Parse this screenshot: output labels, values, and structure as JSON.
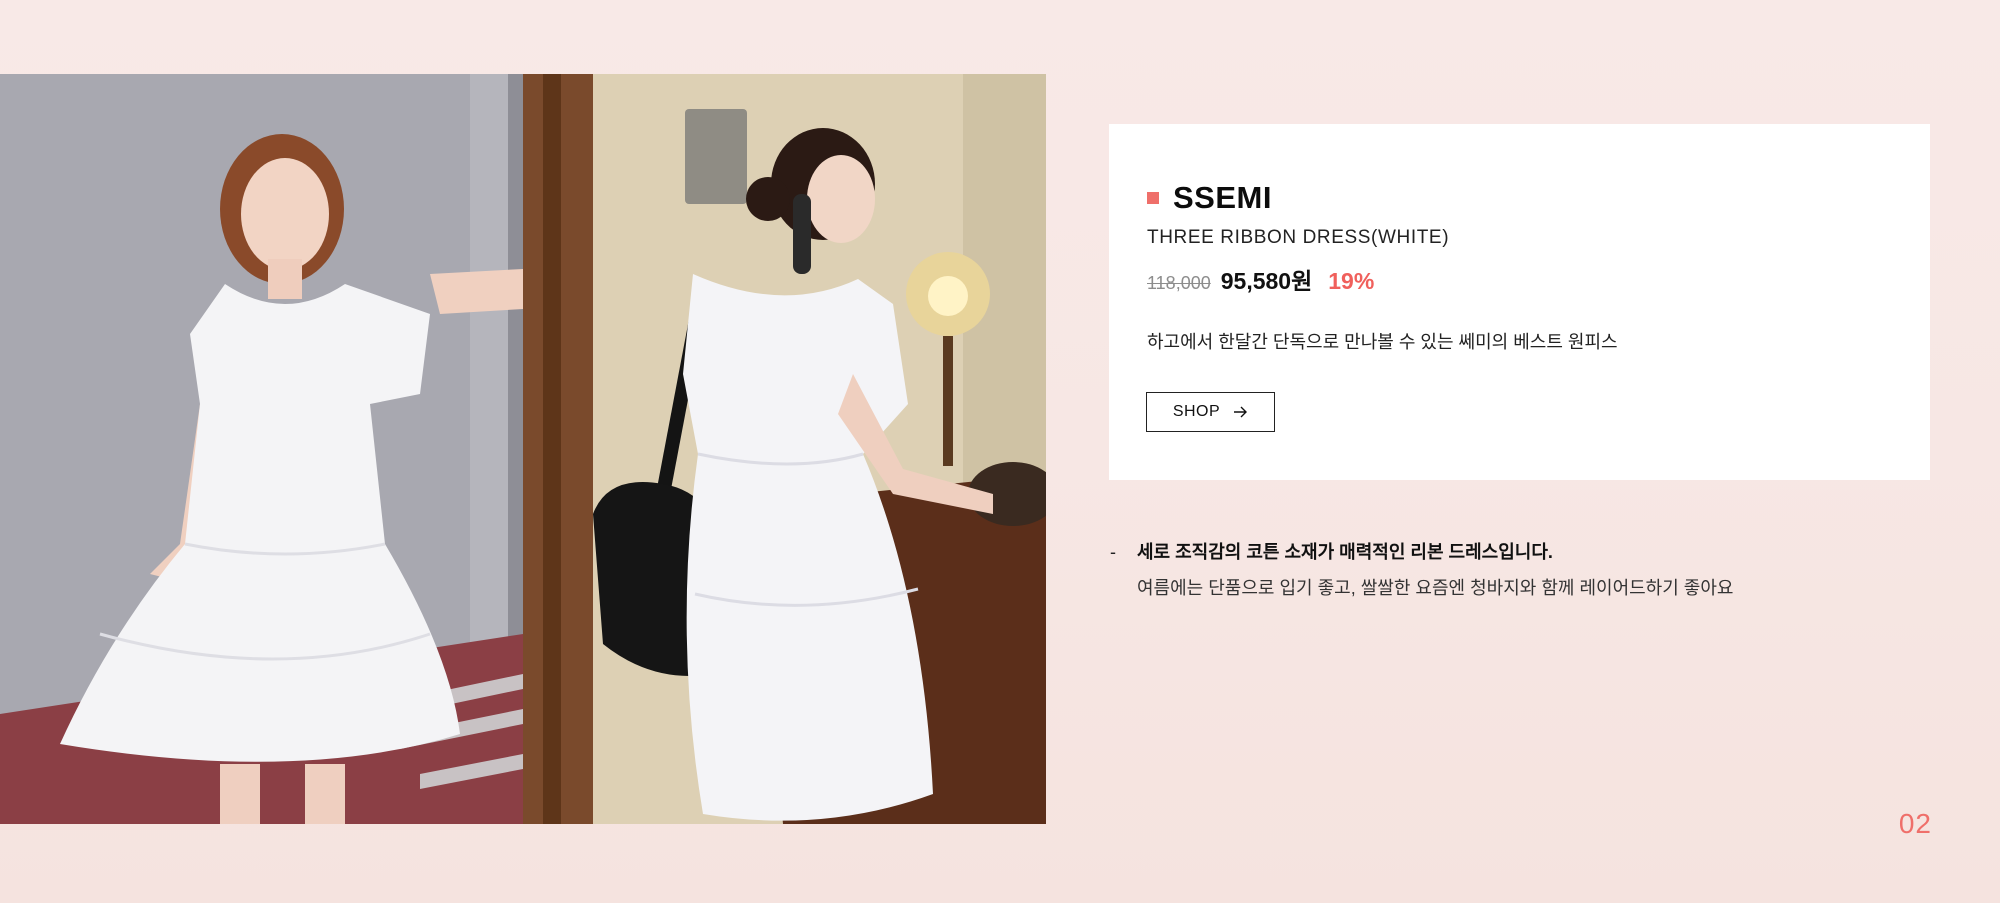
{
  "product": {
    "brand": "SSEMI",
    "name": "THREE RIBBON DRESS(WHITE)",
    "original_price": "118,000",
    "sale_price": "95,580원",
    "discount": "19%",
    "description": "하고에서 한달간 단독으로 만나볼 수 있는 쎄미의 베스트 원피스",
    "shop_button_label": "SHOP",
    "shop_icon": "arrow-right-icon"
  },
  "notes": {
    "dash": "-",
    "headline": "세로 조직감의 코튼 소재가 매력적인 리본 드레스입니다.",
    "detail": "여름에는 단품으로 입기 좋고, 쌀쌀한 요즘엔 청바지와 함께 레이어드하기 좋아요"
  },
  "page_number": "02",
  "colors": {
    "accent": "#ef6f6a",
    "discount": "#f0605c",
    "background": "#f8e9e7",
    "card": "#ffffff"
  }
}
